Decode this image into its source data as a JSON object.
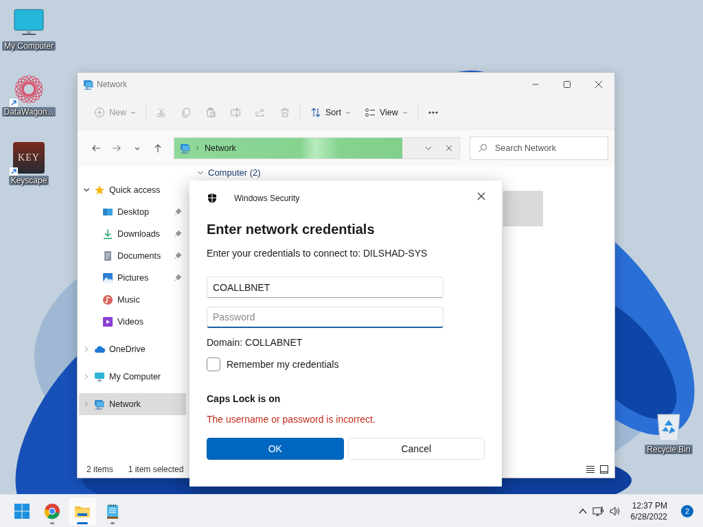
{
  "desktop_icons": [
    {
      "label": "My Computer",
      "kind": "computer",
      "shortcut": false
    },
    {
      "label": "DataWagon...",
      "kind": "datawagon",
      "shortcut": true
    },
    {
      "label": "Keyscape",
      "kind": "keyscape",
      "shortcut": true,
      "logo_text": "KEY"
    },
    {
      "label": "Recycle Bin",
      "kind": "recycle",
      "shortcut": false
    }
  ],
  "explorer": {
    "title": "Network",
    "toolbar": [
      {
        "kind": "new",
        "label": "New",
        "disabled": true
      },
      {
        "kind": "cut",
        "disabled": true
      },
      {
        "kind": "copy",
        "disabled": true
      },
      {
        "kind": "paste",
        "disabled": true
      },
      {
        "kind": "rename",
        "disabled": true
      },
      {
        "kind": "share",
        "disabled": true
      },
      {
        "kind": "delete",
        "disabled": true
      },
      {
        "kind": "sort",
        "label": "Sort",
        "disabled": false
      },
      {
        "kind": "view",
        "label": "View",
        "disabled": false
      },
      {
        "kind": "more",
        "disabled": false
      }
    ],
    "address": {
      "location": "Network",
      "loading": {
        "level": 0.8
      }
    },
    "search": {
      "placeholder": "Search Network"
    },
    "sidebar": {
      "items": [
        {
          "label": "Quick access",
          "kind": "star",
          "expanded": true,
          "selected": false,
          "children": [
            {
              "label": "Desktop",
              "kind": "desktop",
              "pinned": true,
              "selected": false
            },
            {
              "label": "Downloads",
              "kind": "download",
              "pinned": true,
              "selected": false
            },
            {
              "label": "Documents",
              "kind": "document",
              "pinned": true,
              "selected": false
            },
            {
              "label": "Pictures",
              "kind": "picture",
              "pinned": true,
              "selected": false
            },
            {
              "label": "Music",
              "kind": "music",
              "pinned": false,
              "selected": false
            },
            {
              "label": "Videos",
              "kind": "video",
              "pinned": false,
              "selected": false
            }
          ]
        },
        {
          "label": "OneDrive",
          "kind": "cloud",
          "expanded": false,
          "selected": false
        },
        {
          "label": "My Computer",
          "kind": "computer",
          "expanded": false,
          "selected": false
        },
        {
          "label": "Network",
          "kind": "network",
          "expanded": false,
          "selected": true
        }
      ]
    },
    "content": {
      "groups": [
        {
          "label": "Computer (2)",
          "expanded": true
        }
      ]
    },
    "status_bar": {
      "item_count": "2 items",
      "selection": "1 item selected"
    }
  },
  "dialog": {
    "app_name": "Windows Security",
    "title": "Enter network credentials",
    "message": "Enter your credentials to connect to: DILSHAD-SYS",
    "username": {
      "value": "COALLBNET"
    },
    "password": {
      "placeholder": "Password",
      "focused": true
    },
    "domain": "Domain: COLLABNET",
    "remember": {
      "label": "Remember my credentials",
      "checked": false
    },
    "caps_lock_notice": "Caps Lock is on",
    "error": "The username or password is incorrect.",
    "buttons": [
      {
        "label": "OK",
        "kind": "primary"
      },
      {
        "label": "Cancel",
        "kind": "secondary"
      }
    ]
  },
  "taskbar": {
    "apps": [
      {
        "kind": "start",
        "running": false,
        "active": false
      },
      {
        "kind": "chrome",
        "running": true,
        "active": false
      },
      {
        "kind": "explorer",
        "running": true,
        "active": true
      },
      {
        "kind": "notepad",
        "running": true,
        "active": false
      }
    ],
    "tray": {
      "time": "12:37 PM",
      "date": "6/28/2022",
      "notification_count": "2"
    }
  }
}
